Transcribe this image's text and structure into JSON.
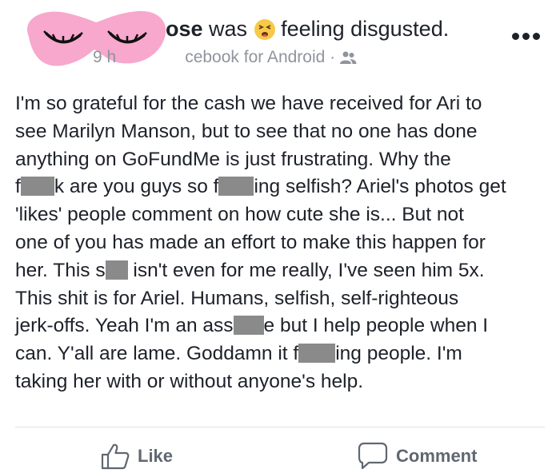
{
  "post": {
    "name_visible": "ose",
    "action_text": "was",
    "feeling_text": "feeling disgusted.",
    "time_visible": "9 h",
    "via_visible": "cebook for Android",
    "dot_separator": "·",
    "audience_icon": "friends-icon",
    "more_icon": "more-options-icon",
    "body_lines": [
      [
        "I'm so grateful for the cash we have received for Ari to"
      ],
      [
        "see Marilyn Manson, but to see that no one has done"
      ],
      [
        "anything on GoFundMe is just frustrating. Why the"
      ],
      [
        "f",
        "k are you guys so f",
        "ing selfish? Ariel's photos get"
      ],
      [
        "'likes' people comment on how cute she is... But not"
      ],
      [
        "one of you has made an effort to make this happen for"
      ],
      [
        "her. This s",
        " isn't even for me really, I've seen him 5x."
      ],
      [
        "This shit is for Ariel. Humans, selfish, self-righteous"
      ],
      [
        "jerk-offs. Yeah I'm an ass",
        "e but I help people when I"
      ],
      [
        "can. Y'all are lame. Goddamn it f",
        "ing people. I'm"
      ],
      [
        "taking her with or without anyone's help."
      ]
    ]
  },
  "actions": {
    "like_label": "Like",
    "comment_label": "Comment"
  },
  "colors": {
    "text": "#1d2129",
    "meta": "#90949c",
    "action": "#606770",
    "redaction": "#8a8a8a",
    "mask_pink": "#f7a8cc"
  }
}
